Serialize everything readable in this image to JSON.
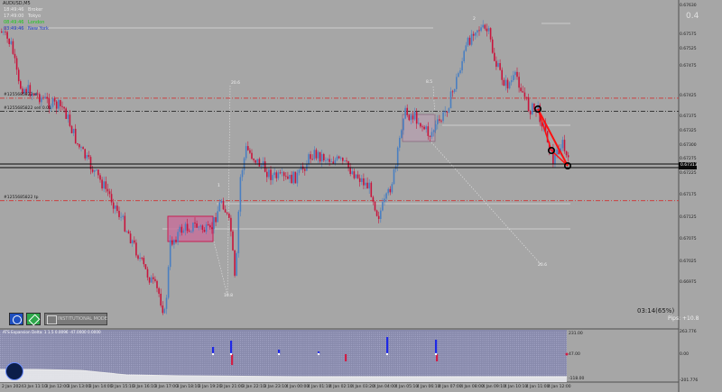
{
  "symbol": "AUDUSD,M5",
  "sessions": [
    {
      "time": "18:49:46",
      "name": "Broker",
      "color": "#e8e8e8"
    },
    {
      "time": "17:49:00",
      "name": "Tokyo",
      "color": "#e8e8e8"
    },
    {
      "time": "08:49:46",
      "name": "London",
      "color": "#19c819"
    },
    {
      "time": "03:49:46",
      "name": "New York",
      "color": "#1e3cc8"
    }
  ],
  "corner_value": "0.4",
  "countdown": "03:14(65%)",
  "pips": "Pips: +10.8",
  "brand_label": "INSTITUTIONAL MODE",
  "order_levels": [
    {
      "label": "#1255685822 sl",
      "price": 0.67455,
      "color": "#d23232"
    },
    {
      "label": "#1255685822 sell 0.01",
      "price": 0.67425,
      "color": "#282828"
    },
    {
      "label": "#1255685822 tp",
      "price": 0.67222,
      "color": "#d23232"
    }
  ],
  "current_price": "0.67313",
  "price_axis": [
    "0.67630",
    "0.67575",
    "0.67525",
    "0.67475",
    "0.67425",
    "0.67375",
    "0.67325",
    "0.67300",
    "0.67275",
    "0.67225",
    "0.67175",
    "0.67125",
    "0.67075",
    "0.67025",
    "0.66975"
  ],
  "time_axis": [
    "2 Jan 2024",
    "3 Jan 11:10",
    "3 Jan 12:00",
    "3 Jan 13:00",
    "3 Jan 14:00",
    "3 Jan 15:10",
    "3 Jan 16:10",
    "3 Jan 17:00",
    "3 Jan 18:10",
    "3 Jan 19:20",
    "3 Jan 21:00",
    "3 Jan 22:10",
    "3 Jan 23:10",
    "4 Jan 00:00",
    "4 Jan 01:10",
    "4 Jan 02:10",
    "4 Jan 03:20",
    "4 Jan 04:00",
    "4 Jan 05:10",
    "4 Jan 06:10",
    "4 Jan 07:00",
    "4 Jan 08:00",
    "4 Jan 09:10",
    "4 Jan 10:10",
    "4 Jan 11:00",
    "4 Jan 12:00"
  ],
  "zones": [
    {
      "label": "20.6"
    },
    {
      "label": "8.5"
    },
    {
      "label": "1"
    },
    {
      "label": "2"
    },
    {
      "label": "10.8"
    },
    {
      "label": "20.6"
    }
  ],
  "indicator": {
    "title": "ATS Expansion Delta: 1 1.5 0.0096 -47.0000 0.0000",
    "axis": [
      "263.776",
      "231.00",
      "47.00",
      "0.00",
      "-118.00",
      "-201.776"
    ]
  },
  "colors": {
    "bull": "#4a7fc1",
    "bear": "#c8143c",
    "accent": "#ff0000"
  }
}
